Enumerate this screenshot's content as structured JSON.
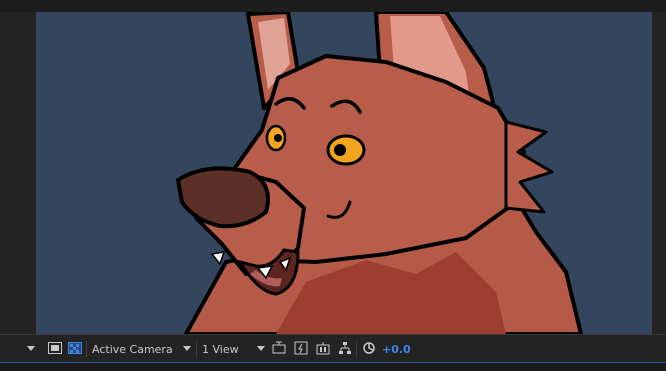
{
  "viewer": {
    "background_color": "#34465e"
  },
  "toolbar": {
    "camera_dropdown": {
      "label": "Active Camera"
    },
    "view_dropdown": {
      "label": "1 View"
    },
    "exposure_value": "+0.0"
  },
  "icons": [
    "chevron-down-icon",
    "toggle-mask-icon",
    "transparency-grid-icon",
    "chevron-down-icon",
    "chevron-down-icon",
    "fit-view-icon",
    "fast-preview-icon",
    "timeline-icon",
    "flowchart-icon",
    "reset-exposure-icon"
  ],
  "colors": {
    "accent": "#3f86e8",
    "panel": "#232323"
  }
}
